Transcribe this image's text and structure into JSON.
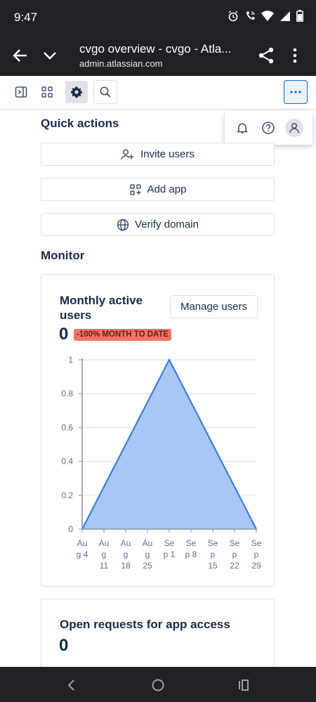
{
  "status_bar": {
    "time": "9:47"
  },
  "browser": {
    "title": "cvgo overview - cvgo - Atla...",
    "url": "admin.atlassian.com"
  },
  "quick_actions": {
    "title": "Quick actions",
    "buttons": [
      {
        "label": "Invite users",
        "icon": "person-add-icon"
      },
      {
        "label": "Add app",
        "icon": "app-add-icon"
      },
      {
        "label": "Verify domain",
        "icon": "globe-icon"
      }
    ]
  },
  "monitor": {
    "title": "Monitor",
    "mau_card": {
      "title": "Monthly active users",
      "manage_label": "Manage users",
      "value": "0",
      "badge": "-100% MONTH TO DATE",
      "badge_color": "#f87168"
    },
    "requests_card": {
      "title": "Open requests for app access",
      "value": "0"
    }
  },
  "chart_data": {
    "type": "area",
    "x": [
      "Aug 4",
      "Aug 11",
      "Aug 18",
      "Aug 25",
      "Sep 1",
      "Sep 8",
      "Sep 15",
      "Sep 22",
      "Sep 29"
    ],
    "x_labels_wrapped": [
      [
        "Au",
        "g 4"
      ],
      [
        "Au",
        "g",
        "11"
      ],
      [
        "Au",
        "g",
        "18"
      ],
      [
        "Au",
        "g",
        "25"
      ],
      [
        "Se",
        "p 1"
      ],
      [
        "Se",
        "p 8"
      ],
      [
        "Se",
        "p",
        "15"
      ],
      [
        "Se",
        "p",
        "22"
      ],
      [
        "Se",
        "p",
        "29"
      ]
    ],
    "series": [
      {
        "values": [
          0,
          0.25,
          0.5,
          0.75,
          1,
          0.75,
          0.5,
          0.25,
          0
        ]
      }
    ],
    "y_ticks": [
      "0",
      "0.2",
      "0.4",
      "0.6",
      "0.8",
      "1"
    ],
    "ylim": [
      0,
      1
    ],
    "grid": true,
    "fill_color": "#a9c6f7",
    "line_color": "#3b7ddd",
    "title": "",
    "xlabel": "",
    "ylabel": ""
  }
}
